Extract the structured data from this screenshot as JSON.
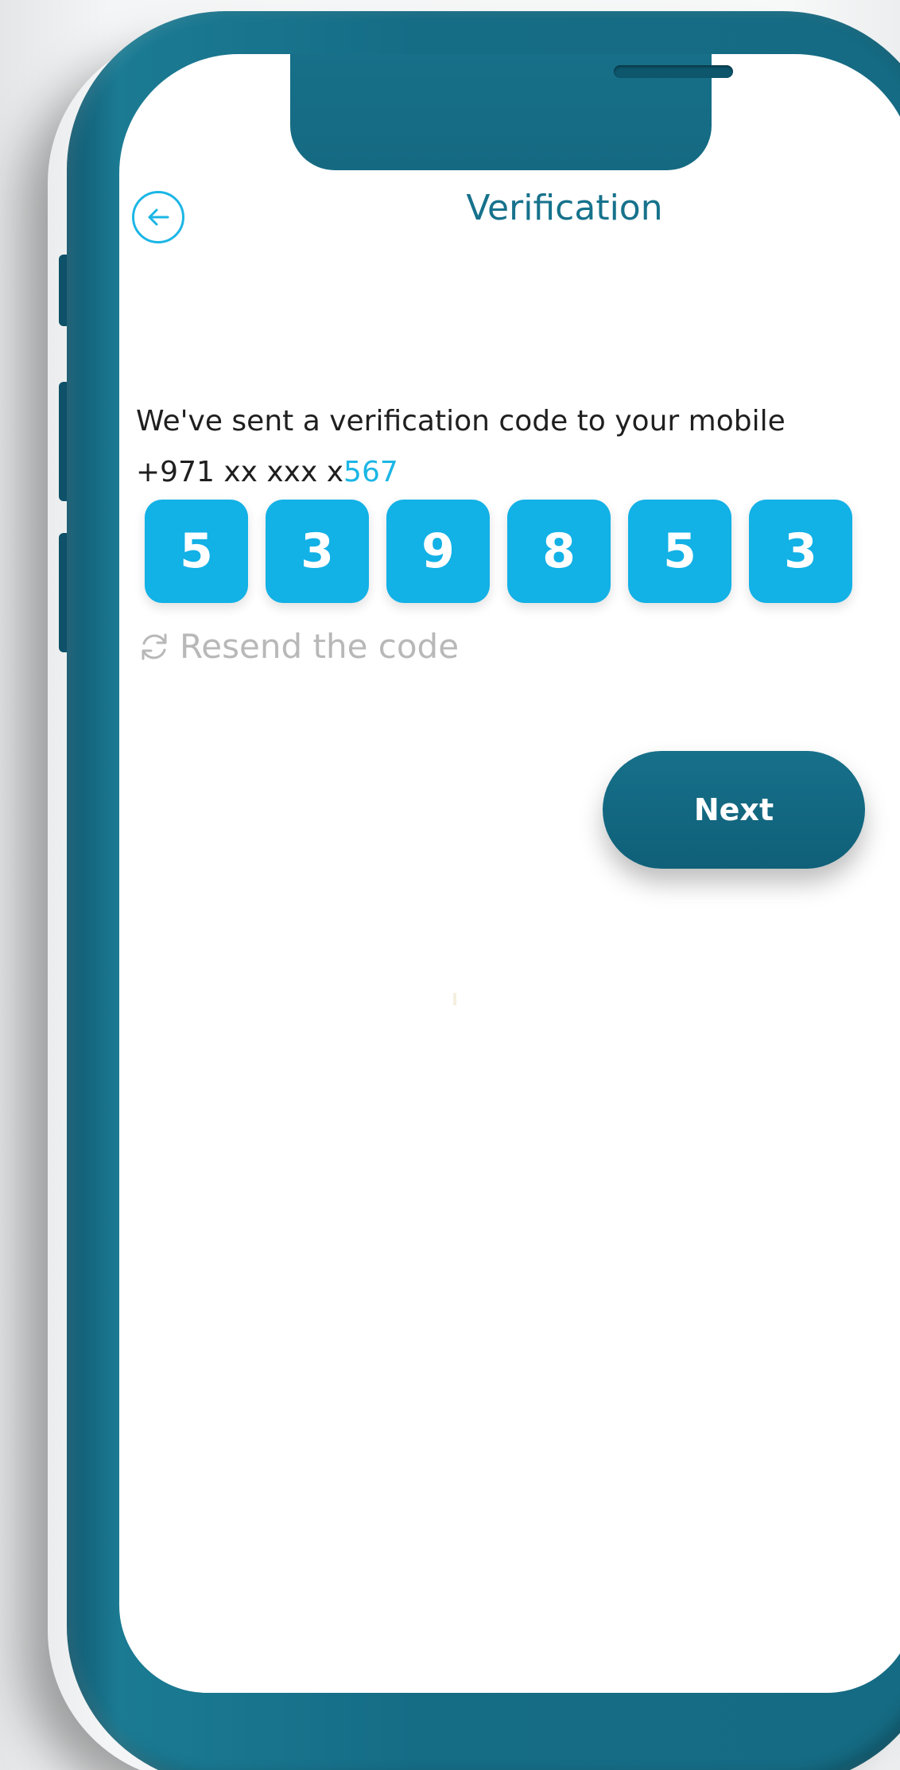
{
  "header": {
    "title": "Verification",
    "back_icon": "arrow-left-circle-icon"
  },
  "message": {
    "line1": "We've sent a verification code to your mobile",
    "phone_prefix": "+971 xx xxx x",
    "phone_suffix": "567"
  },
  "otp": {
    "digits": [
      "5",
      "3",
      "9",
      "8",
      "5",
      "3"
    ]
  },
  "resend": {
    "label": "Resend the code",
    "icon": "refresh-icon"
  },
  "next_button": {
    "label": "Next"
  },
  "colors": {
    "accent": "#1bb6e5",
    "primary": "#17728c",
    "frame": "#156b83",
    "disabled_text": "#b8b8b8"
  }
}
